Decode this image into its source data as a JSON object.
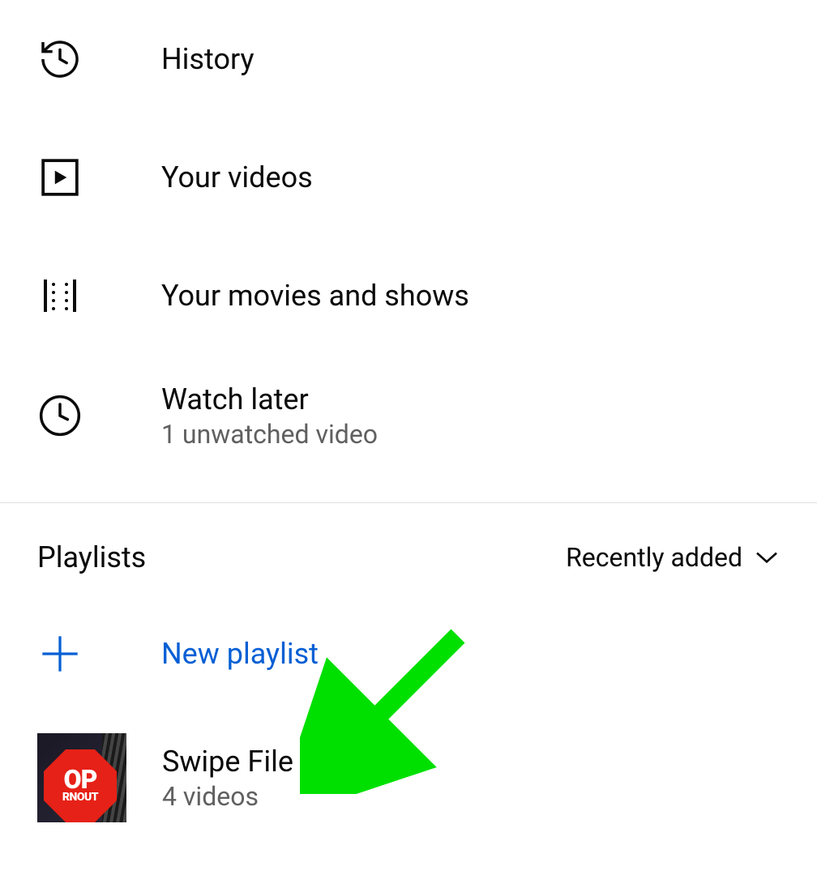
{
  "menu": {
    "history": {
      "label": "History"
    },
    "your_videos": {
      "label": "Your videos"
    },
    "movies_shows": {
      "label": "Your movies and shows"
    },
    "watch_later": {
      "label": "Watch later",
      "subtitle": "1 unwatched video"
    }
  },
  "playlists": {
    "header_title": "Playlists",
    "sort_label": "Recently added",
    "new_playlist_label": "New playlist",
    "items": [
      {
        "name": "Swipe File",
        "count": "4 videos",
        "thumb_text_1": "OP",
        "thumb_text_2": "RNOUT"
      }
    ]
  }
}
